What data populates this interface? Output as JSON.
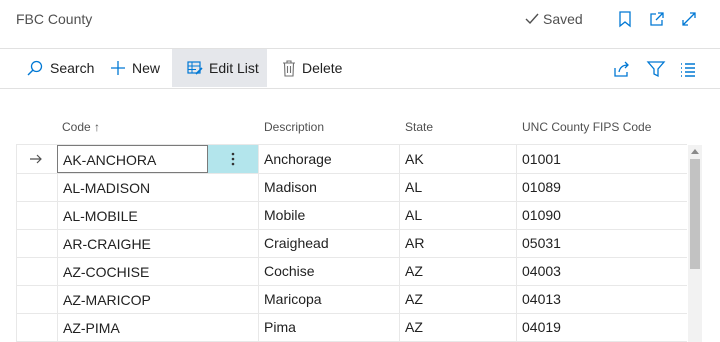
{
  "page": {
    "title": "FBC County",
    "saved_label": "Saved"
  },
  "actions": {
    "search": "Search",
    "new": "New",
    "edit_list": "Edit List",
    "delete": "Delete"
  },
  "columns": {
    "code": "Code ↑",
    "description": "Description",
    "state": "State",
    "fips": "UNC County FIPS Code"
  },
  "rows": [
    {
      "code": "AK-ANCHORA",
      "description": "Anchorage",
      "state": "AK",
      "fips": "01001"
    },
    {
      "code": "AL-MADISON",
      "description": "Madison",
      "state": "AL",
      "fips": "01089"
    },
    {
      "code": "AL-MOBILE",
      "description": "Mobile",
      "state": "AL",
      "fips": "01090"
    },
    {
      "code": "AR-CRAIGHE",
      "description": "Craighead",
      "state": "AR",
      "fips": "05031"
    },
    {
      "code": "AZ-COCHISE",
      "description": "Cochise",
      "state": "AZ",
      "fips": "04003"
    },
    {
      "code": "AZ-MARICOP",
      "description": "Maricopa",
      "state": "AZ",
      "fips": "04013"
    },
    {
      "code": "AZ-PIMA",
      "description": "Pima",
      "state": "AZ",
      "fips": "04019"
    }
  ],
  "icons": {
    "saved_check": "check-icon",
    "bookmark": "bookmark-icon",
    "open_new": "open-in-new-window-icon",
    "expand": "expand-icon",
    "search": "search-icon",
    "new": "plus-icon",
    "edit_list": "edit-list-icon",
    "delete": "trash-icon",
    "share": "share-icon",
    "filter": "filter-icon",
    "list_view": "list-view-icon",
    "row_selector": "arrow-right-icon",
    "row_menu": "vertical-ellipsis-icon"
  },
  "colors": {
    "accent": "#0078d4",
    "selected_cell": "#b3e5ec",
    "active_action": "#e5e7eb"
  }
}
